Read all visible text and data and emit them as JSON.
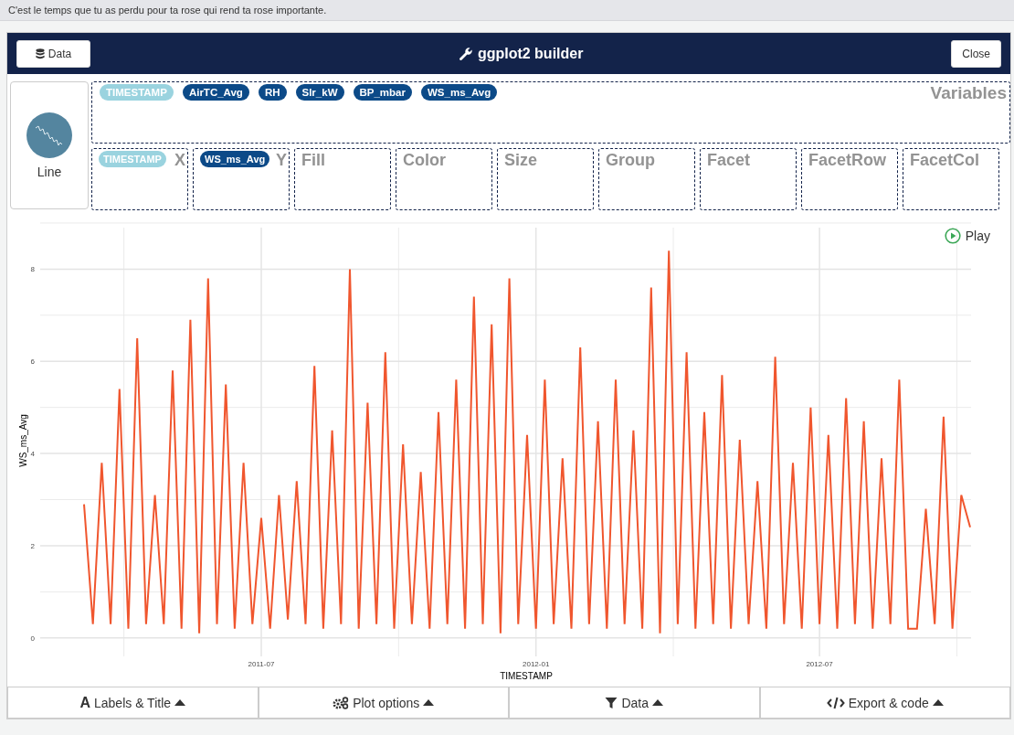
{
  "top_bar": {
    "quote": "C'est le temps que tu as perdu pour ta rose qui rend ta rose importante."
  },
  "header": {
    "data_button": "Data",
    "title": "ggplot2 builder",
    "close_button": "Close"
  },
  "chart_type": {
    "label": "Line"
  },
  "variables": {
    "placeholder": "Variables",
    "chips": [
      {
        "label": "TIMESTAMP",
        "kind": "time"
      },
      {
        "label": "AirTC_Avg",
        "kind": "numeric"
      },
      {
        "label": "RH",
        "kind": "numeric"
      },
      {
        "label": "Slr_kW",
        "kind": "numeric"
      },
      {
        "label": "BP_mbar",
        "kind": "numeric"
      },
      {
        "label": "WS_ms_Avg",
        "kind": "numeric"
      }
    ]
  },
  "aesthetics": [
    {
      "label": "X",
      "chip": {
        "label": "TIMESTAMP",
        "kind": "time"
      }
    },
    {
      "label": "Y",
      "chip": {
        "label": "WS_ms_Avg",
        "kind": "numeric"
      }
    },
    {
      "label": "Fill"
    },
    {
      "label": "Color"
    },
    {
      "label": "Size"
    },
    {
      "label": "Group"
    },
    {
      "label": "Facet"
    },
    {
      "label": "FacetRow"
    },
    {
      "label": "FacetCol"
    }
  ],
  "plot": {
    "play_button": "Play",
    "chart_data": {
      "type": "line",
      "xlabel": "TIMESTAMP",
      "ylabel": "WS_ms_Avg",
      "grid": true,
      "ylim": [
        -0.4,
        8.9
      ],
      "yticks": [
        0,
        2,
        4,
        6,
        8
      ],
      "categories": [
        null,
        null,
        null,
        null,
        null,
        null,
        null,
        null,
        null,
        null,
        null,
        null,
        null,
        null,
        null,
        null,
        null,
        null,
        null,
        null,
        "2011-07",
        null,
        null,
        null,
        null,
        null,
        null,
        null,
        null,
        null,
        null,
        null,
        null,
        null,
        null,
        null,
        null,
        null,
        null,
        null,
        null,
        null,
        null,
        null,
        null,
        null,
        null,
        null,
        null,
        null,
        null,
        "2012-01",
        null,
        null,
        null,
        null,
        null,
        null,
        null,
        null,
        null,
        null,
        null,
        null,
        null,
        null,
        null,
        null,
        null,
        null,
        null,
        null,
        null,
        null,
        null,
        null,
        null,
        null,
        null,
        null,
        null,
        null,
        null,
        "2012-07",
        null,
        null,
        null,
        null,
        null,
        null,
        null,
        null,
        null,
        null,
        null,
        null,
        null,
        null,
        null,
        null,
        null
      ],
      "series": [
        {
          "color": "#f0562e",
          "values": [
            2.9,
            0.3,
            3.8,
            0.3,
            5.4,
            0.2,
            6.5,
            0.3,
            3.1,
            0.3,
            5.8,
            0.2,
            6.9,
            0.1,
            7.8,
            0.3,
            5.5,
            0.2,
            3.8,
            0.3,
            2.6,
            0.2,
            3.1,
            0.4,
            3.4,
            0.3,
            5.9,
            0.2,
            4.5,
            0.3,
            8.0,
            0.2,
            5.1,
            0.3,
            6.2,
            0.2,
            4.2,
            0.3,
            3.6,
            0.2,
            4.9,
            0.3,
            5.6,
            0.2,
            7.4,
            0.3,
            6.8,
            0.1,
            7.8,
            0.3,
            4.4,
            0.2,
            5.6,
            0.3,
            3.9,
            0.2,
            6.3,
            0.3,
            4.7,
            0.2,
            5.6,
            0.3,
            4.5,
            0.2,
            7.6,
            0.1,
            8.4,
            0.3,
            6.2,
            0.2,
            4.9,
            0.3,
            5.7,
            0.2,
            4.3,
            0.3,
            3.4,
            0.2,
            6.1,
            0.3,
            3.8,
            0.2,
            5.0,
            0.3,
            4.4,
            0.2,
            5.2,
            0.3,
            4.7,
            0.2,
            3.9,
            0.3,
            5.6,
            0.2,
            0.2,
            2.8,
            0.3,
            4.8,
            0.2,
            3.1,
            2.4
          ]
        }
      ]
    }
  },
  "footer": [
    {
      "kind": "labels",
      "icon_text": "A",
      "label": "Labels & Title"
    },
    {
      "kind": "options",
      "label": "Plot options"
    },
    {
      "kind": "filter",
      "label": "Data"
    },
    {
      "kind": "code",
      "label": "Export & code"
    }
  ]
}
